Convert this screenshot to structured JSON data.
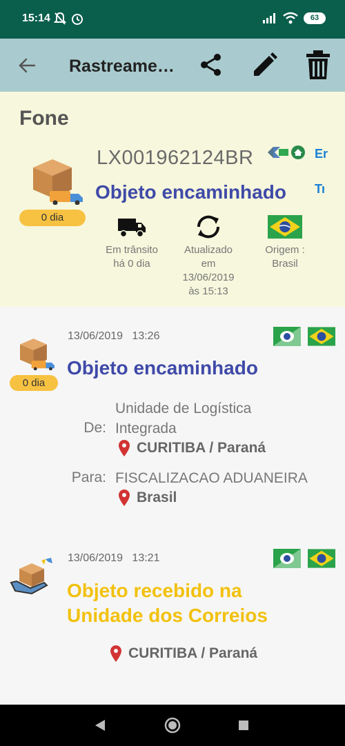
{
  "status_bar": {
    "time": "15:14",
    "battery": "63"
  },
  "app_bar": {
    "title": "Rastreame…"
  },
  "summary": {
    "name": "Fone",
    "days_badge": "0 dia",
    "tracking_code": "LX001962124BR",
    "status": "Objeto encaminhado",
    "side_text_1": "Er",
    "side_text_2": "Tr",
    "transit_label": [
      "Em trânsito",
      "há 0 dia"
    ],
    "updated_label": [
      "Atualizado",
      "em",
      "13/06/2019",
      "às 15:13"
    ],
    "origin_label": [
      "Origem :",
      "Brasil"
    ]
  },
  "events": [
    {
      "date": "13/06/2019",
      "time": "13:26",
      "days_badge": "0 dia",
      "title": "Objeto encaminhado",
      "from_label": "De:",
      "from_value": [
        "Unidade de Logística",
        "Integrada"
      ],
      "from_location": "CURITIBA / Paraná",
      "to_label": "Para:",
      "to_value": "FISCALIZACAO ADUANEIRA",
      "to_location": "Brasil"
    },
    {
      "date": "13/06/2019",
      "time": "13:21",
      "title": [
        "Objeto recebido na",
        "Unidade dos Correios"
      ],
      "location": "CURITIBA / Paraná"
    }
  ],
  "colors": {
    "status_bar": "#0a5e4c",
    "app_bar": "#a9cbcf",
    "summary_bg": "#f6f7dc",
    "status_blue": "#3f4aa8",
    "status_yellow": "#f2c10d",
    "badge": "#f7c242",
    "pin_red": "#d23333"
  },
  "icons": [
    "back-arrow-icon",
    "share-icon",
    "edit-icon",
    "trash-icon",
    "package-truck-icon",
    "truck-icon",
    "refresh-icon",
    "brazil-flag-icon",
    "location-pin-icon",
    "hand-package-icon"
  ]
}
